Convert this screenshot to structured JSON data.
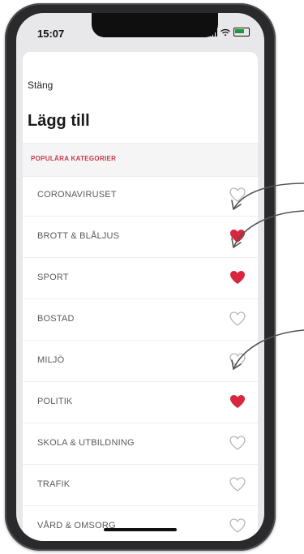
{
  "status": {
    "time": "15:07"
  },
  "sheet": {
    "close_label": "Stäng",
    "title": "Lägg till",
    "section_label": "POPULÄRA KATEGORIER"
  },
  "categories": [
    {
      "label": "CORONAVIRUSET",
      "favorited": false
    },
    {
      "label": "BROTT & BLÅLJUS",
      "favorited": true
    },
    {
      "label": "SPORT",
      "favorited": true
    },
    {
      "label": "BOSTAD",
      "favorited": false
    },
    {
      "label": "MILJÖ",
      "favorited": false
    },
    {
      "label": "POLITIK",
      "favorited": true
    },
    {
      "label": "SKOLA & UTBILDNING",
      "favorited": false
    },
    {
      "label": "TRAFIK",
      "favorited": false
    },
    {
      "label": "VÅRD & OMSORG",
      "favorited": false
    }
  ],
  "colors": {
    "heart_filled": "#d7263d",
    "heart_outline": "#b5b5b5",
    "accent": "#c83a4a"
  }
}
